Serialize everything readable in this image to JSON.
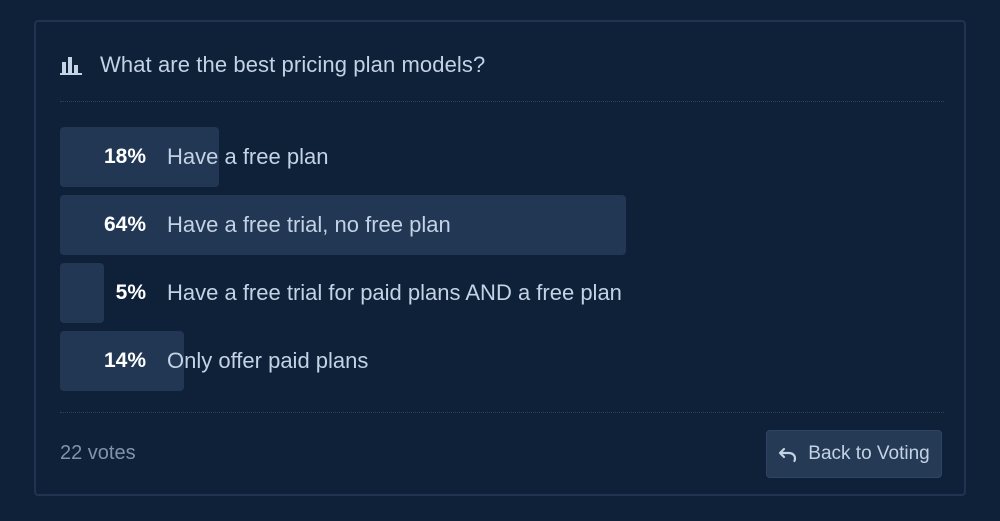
{
  "poll": {
    "question": "What are the best pricing plan models?",
    "icon": "bar-chart-icon",
    "options": [
      {
        "percent_label": "18%",
        "percent": 18,
        "label": "Have a free plan"
      },
      {
        "percent_label": "64%",
        "percent": 64,
        "label": "Have a free trial, no free plan"
      },
      {
        "percent_label": "5%",
        "percent": 5,
        "label": "Have a free trial for paid plans AND a free plan"
      },
      {
        "percent_label": "14%",
        "percent": 14,
        "label": "Only offer paid plans"
      }
    ],
    "vote_count": "22 votes"
  },
  "actions": {
    "back_label": "Back to Voting",
    "back_icon": "undo-icon"
  },
  "colors": {
    "background": "#0f2139",
    "bar": "#213753",
    "button": "#253a55",
    "text": "#c3d2e4",
    "muted_text": "#7f93ab"
  }
}
